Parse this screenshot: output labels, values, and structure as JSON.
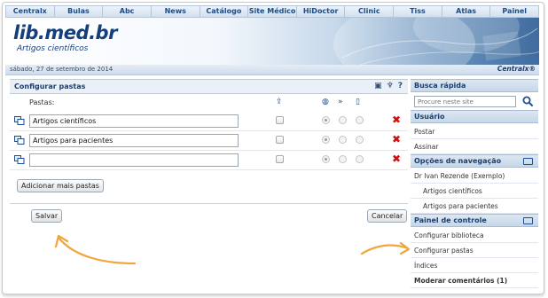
{
  "nav": [
    "Centralx",
    "Bulas",
    "Abc",
    "News",
    "Catálogo",
    "Site Médico",
    "HiDoctor",
    "Clinic",
    "Tiss",
    "Atlas",
    "Painel"
  ],
  "banner": {
    "title": "lib.med.br",
    "subtitle": "Artigos científicos"
  },
  "datebar": {
    "date": "sábado, 27 de setembro de 2014",
    "brand": "Centralx®"
  },
  "panel": {
    "title": "Configurar pastas",
    "pastas_label": "Pastas:",
    "rows": [
      {
        "value": "Artigos científicos"
      },
      {
        "value": "Artigos para pacientes"
      },
      {
        "value": ""
      }
    ],
    "add_button": "Adicionar mais pastas",
    "save_button": "Salvar",
    "cancel_button": "Cancelar"
  },
  "sidebar": {
    "busca": {
      "title": "Busca rápida",
      "placeholder": "Procure neste site"
    },
    "usuario": {
      "title": "Usuário",
      "items": [
        "Postar",
        "Assinar"
      ]
    },
    "navegacao": {
      "title": "Opções de navegação",
      "user": "Dr Ivan Rezende (Exemplo)",
      "items": [
        "Artigos científicos",
        "Artigos para pacientes"
      ]
    },
    "controle": {
      "title": "Painel de controle",
      "items": [
        "Configurar biblioteca",
        "Configurar pastas",
        "Índices"
      ],
      "moderar": "Moderar comentários (1)"
    }
  },
  "colors": {
    "accent": "#1a3e6d",
    "delete": "#d21010",
    "arrow": "#f2a53a"
  }
}
